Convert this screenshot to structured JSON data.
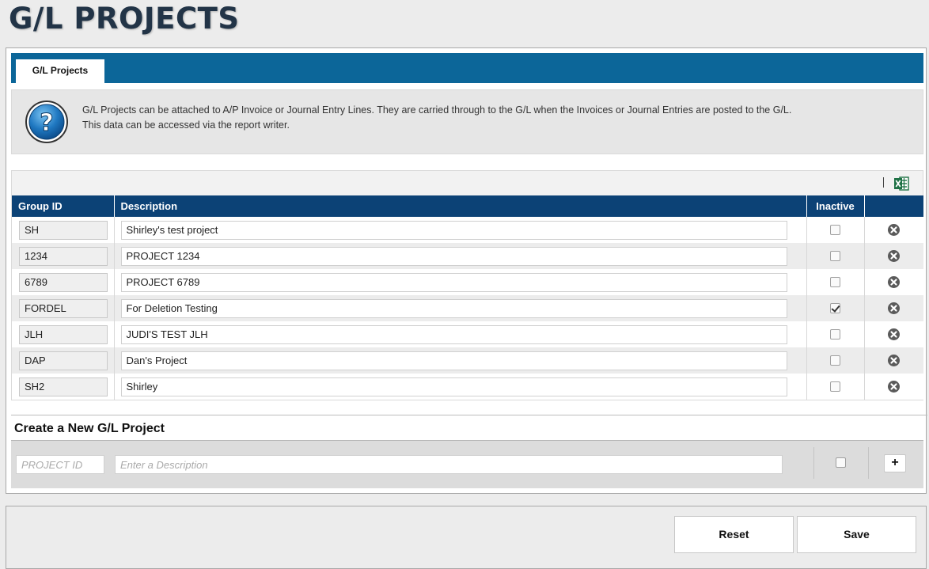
{
  "page": {
    "title": "G/L PROJECTS"
  },
  "tabs": [
    {
      "label": "G/L Projects",
      "active": true
    }
  ],
  "info": {
    "icon": "help-question-icon",
    "line1": "G/L Projects can be attached to A/P Invoice or Journal Entry Lines. They are carried through to the G/L when the Invoices or Journal Entries are posted to the G/L.",
    "line2": "This data can be accessed via the report writer."
  },
  "toolbar": {
    "export_icon": "excel-export-icon"
  },
  "grid": {
    "columns": {
      "group_id": "Group ID",
      "description": "Description",
      "inactive": "Inactive",
      "actions": ""
    },
    "rows": [
      {
        "group_id": "SH",
        "description": "Shirley's test project",
        "inactive": false
      },
      {
        "group_id": "1234",
        "description": "PROJECT 1234",
        "inactive": false
      },
      {
        "group_id": "6789",
        "description": "PROJECT 6789",
        "inactive": false
      },
      {
        "group_id": "FORDEL",
        "description": "For Deletion Testing",
        "inactive": true
      },
      {
        "group_id": "JLH",
        "description": "JUDI'S TEST JLH",
        "inactive": false
      },
      {
        "group_id": "DAP",
        "description": "Dan's Project",
        "inactive": false
      },
      {
        "group_id": "SH2",
        "description": "Shirley",
        "inactive": false
      }
    ]
  },
  "create": {
    "title": "Create a New G/L Project",
    "id_placeholder": "PROJECT ID",
    "desc_placeholder": "Enter a Description",
    "id_value": "",
    "desc_value": "",
    "inactive": false,
    "add_label": "+"
  },
  "footer": {
    "reset_label": "Reset",
    "save_label": "Save"
  },
  "colors": {
    "tab_bar": "#0c6699",
    "grid_header": "#0c4276",
    "title": "#223447",
    "excel": "#1e7145"
  }
}
